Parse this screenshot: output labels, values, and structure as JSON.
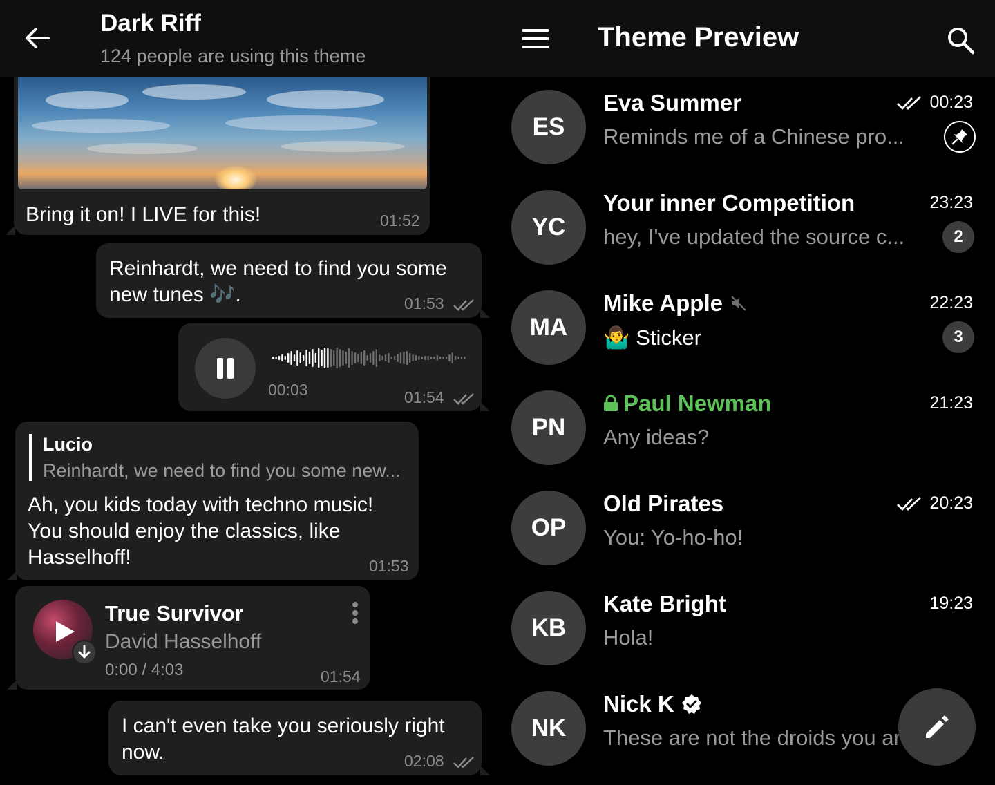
{
  "colors": {
    "bubble": "#1f1f1f",
    "accent_green": "#5dc258",
    "muted": "#9a9a9a",
    "avatar_bg": "#3d3d3d"
  },
  "left": {
    "header": {
      "back_icon": "arrow-left-icon",
      "title": "Dark Riff",
      "subtitle": "124 people are using this theme"
    },
    "messages": {
      "photo_caption": {
        "text": "Bring it on! I LIVE for this!",
        "time": "01:52"
      },
      "tunes": {
        "line1": "Reinhardt, we need to find you some",
        "line2": "new tunes 🎶.",
        "time": "01:53"
      },
      "voice": {
        "duration": "00:03",
        "time": "01:54",
        "progress": 0.3
      },
      "reply": {
        "quote_name": "Lucio",
        "quote_text": "Reinhardt, we need to find you some new...",
        "line1": "Ah, you kids today with techno music!",
        "line2": "You should enjoy the classics, like",
        "line3": "Hasselhoff!",
        "time": "01:53"
      },
      "music": {
        "title": "True Survivor",
        "artist": "David Hasselhoff",
        "duration": "0:00 / 4:03",
        "time": "01:54"
      },
      "last": {
        "line1": "I can't even take you seriously right",
        "line2": "now.",
        "time": "02:08"
      }
    }
  },
  "right": {
    "header": {
      "menu_icon": "hamburger-menu-icon",
      "title": "Theme Preview",
      "search_icon": "search-icon"
    },
    "chats": [
      {
        "initials": "ES",
        "name": "Eva Summer",
        "message": "Reminds me of a Chinese pro...",
        "time": "00:23",
        "read": true,
        "pinned": true
      },
      {
        "initials": "YC",
        "name": "Your inner Competition",
        "message": "hey, I've updated the source c...",
        "time": "23:23",
        "unread": "2"
      },
      {
        "initials": "MA",
        "name": "Mike Apple",
        "message": "Sticker",
        "sticker_emoji": "🤷‍♂️",
        "time": "22:23",
        "unread": "3",
        "muted": true
      },
      {
        "initials": "PN",
        "name": "Paul Newman",
        "message": "Any ideas?",
        "time": "21:23",
        "secret": true
      },
      {
        "initials": "OP",
        "name": "Old Pirates",
        "message": "You: Yo-ho-ho!",
        "time": "20:23",
        "read": true
      },
      {
        "initials": "KB",
        "name": "Kate Bright",
        "message": "Hola!",
        "time": "19:23"
      },
      {
        "initials": "NK",
        "name": "Nick K",
        "message": "These are not the droids you ar",
        "time": "",
        "verified": true
      }
    ],
    "fab_icon": "pencil-icon"
  }
}
